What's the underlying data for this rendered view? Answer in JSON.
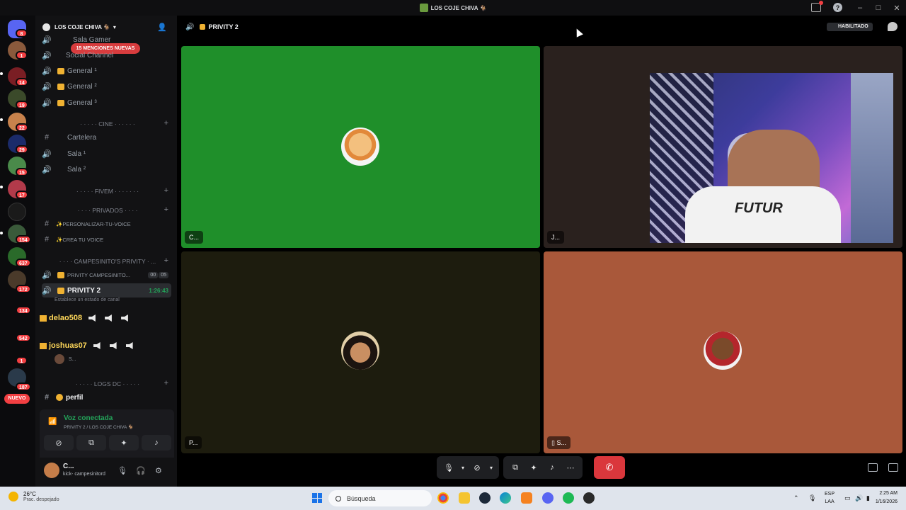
{
  "window": {
    "title": "LOS COJE CHIVA 🐐"
  },
  "rail": {
    "badges": [
      "8",
      "1",
      "14",
      "19",
      "22",
      "29",
      "15",
      "17",
      "154",
      "637",
      "172",
      "134",
      "542",
      "1",
      "187"
    ],
    "new_label": "NUEVO"
  },
  "server": {
    "name": "LOS COJE CHIVA 🐐",
    "mentions": "15 MENCIONES NUEVAS",
    "channels_top": [
      {
        "label": "Sala Gamer"
      },
      {
        "label": "Social Channel"
      },
      {
        "label": "General ¹"
      },
      {
        "label": "General ²"
      },
      {
        "label": "General ³"
      }
    ],
    "cat_cine": "· · · · · CINE · · · · · ·",
    "cine": [
      {
        "label": "Cartelera"
      },
      {
        "label": "Sala ¹"
      },
      {
        "label": "Sala ²"
      }
    ],
    "cat_fivem": "· · · · · FIVEM · · · · · · ·",
    "cat_privados": "· · · · PRIVADOS · · · ·",
    "privados": [
      {
        "label": "✨PERSONALIZAR-TU-VOICE"
      },
      {
        "label": "✨CREA TU VOICE"
      }
    ],
    "cat_privity": "· · · · CAMPESINITO'S PRIVITY · ...",
    "privity1": "PRIVITY CAMPESINITO...",
    "privity1_counts": [
      "00",
      "05"
    ],
    "privity2": "PRIVITY 2",
    "privity2_timer": "1:26:43",
    "privity2_status": "Establece un estado de canal",
    "members": [
      {
        "name": "delao508"
      },
      {
        "name": "joshuas07"
      }
    ],
    "member_hint": "S...",
    "cat_logs": "· · · · · LOGS DC · · · · ·",
    "perfil": "perfil"
  },
  "voice": {
    "status": "Voz conectada",
    "channel": "PRIVITY 2 / LOS COJE CHIVA 🐐"
  },
  "user": {
    "name": "C...",
    "status": "kick- campesinitord"
  },
  "main": {
    "channel": "PRIVITY 2",
    "habilitado": "HABILITADO",
    "tiles": [
      {
        "name": "C...",
        "color": "#1f8f2a"
      },
      {
        "name": "J...",
        "color": "#2a211e"
      },
      {
        "name": "P...",
        "color": "#1d1c0e"
      },
      {
        "name": "S...",
        "color": "#a9583a"
      }
    ]
  },
  "taskbar": {
    "temp": "26°C",
    "weather": "Prac. despejado",
    "search": "Búsqueda",
    "lang1": "ESP",
    "lang2": "LAA",
    "time": "2:25 AM",
    "date": "1/16/2026"
  }
}
